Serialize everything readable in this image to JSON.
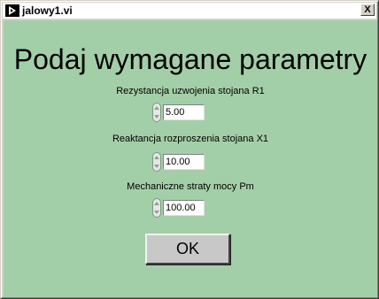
{
  "window": {
    "title": "jalowy1.vi",
    "close_glyph": "X",
    "app_icon": "labview-run-icon",
    "client_bg_color": "#a3cfa8"
  },
  "heading": "Podaj wymagane parametry",
  "fields": [
    {
      "label": "Rezystancja uzwojenia stojana R1",
      "value": "5.00"
    },
    {
      "label": "Reaktancja rozproszenia stojana X1",
      "value": "10.00"
    },
    {
      "label": "Mechaniczne straty mocy Pm",
      "value": "100.00"
    }
  ],
  "ok_button": {
    "label": "OK"
  }
}
